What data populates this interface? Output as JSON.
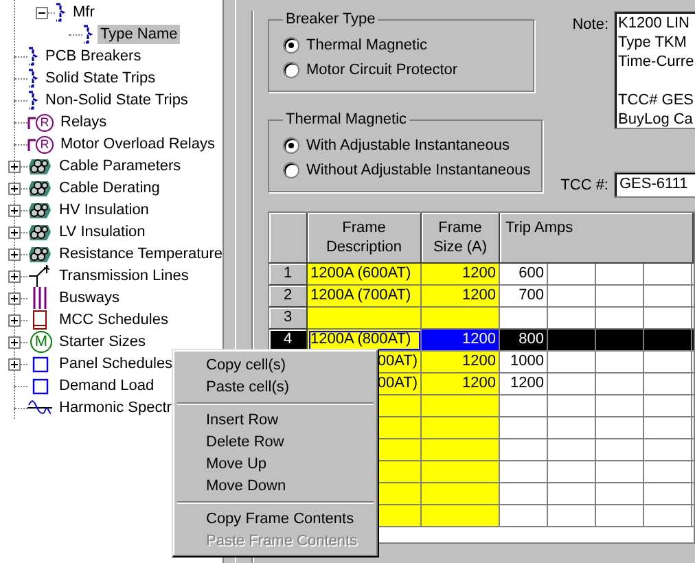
{
  "tree": {
    "continued_children": [
      {
        "label": "Mfr",
        "kind": "bracket",
        "has_children": true,
        "expanded": true,
        "selected": false,
        "children": [
          {
            "label": "Type Name",
            "kind": "bracket",
            "has_children": false,
            "expanded": false,
            "selected": true
          }
        ]
      }
    ],
    "items": [
      {
        "label": "PCB Breakers",
        "kind": "bracket",
        "has_children": false,
        "expanded": false,
        "selected": false
      },
      {
        "label": "Solid State Trips",
        "kind": "bracket",
        "has_children": false,
        "expanded": false,
        "selected": false
      },
      {
        "label": "Non-Solid State Trips",
        "kind": "bracket",
        "has_children": false,
        "expanded": false,
        "selected": false
      },
      {
        "label": "Relays",
        "kind": "relay",
        "badge": "R",
        "has_children": false,
        "expanded": false,
        "selected": false
      },
      {
        "label": "Motor Overload Relays",
        "kind": "relay",
        "badge": "R",
        "has_children": false,
        "expanded": false,
        "selected": false
      },
      {
        "label": "Cable Parameters",
        "kind": "cable",
        "has_children": true,
        "expanded": false,
        "selected": false
      },
      {
        "label": "Cable Derating",
        "kind": "cable",
        "has_children": true,
        "expanded": false,
        "selected": false
      },
      {
        "label": "HV Insulation",
        "kind": "cable",
        "has_children": true,
        "expanded": false,
        "selected": false
      },
      {
        "label": "LV Insulation",
        "kind": "cable",
        "has_children": true,
        "expanded": false,
        "selected": false
      },
      {
        "label": "Resistance Temperature",
        "kind": "cable",
        "has_children": true,
        "expanded": false,
        "selected": false
      },
      {
        "label": "Transmission Lines",
        "kind": "transmission",
        "has_children": true,
        "expanded": false,
        "selected": false
      },
      {
        "label": "Busways",
        "kind": "busway",
        "has_children": true,
        "expanded": false,
        "selected": false
      },
      {
        "label": "MCC Schedules",
        "kind": "mcc",
        "has_children": true,
        "expanded": false,
        "selected": false
      },
      {
        "label": "Starter Sizes",
        "kind": "starter",
        "badge": "M",
        "has_children": true,
        "expanded": false,
        "selected": false
      },
      {
        "label": "Panel Schedules",
        "kind": "panel",
        "has_children": true,
        "expanded": false,
        "selected": false
      },
      {
        "label": "Demand Load",
        "kind": "panel",
        "has_children": false,
        "expanded": false,
        "selected": false
      },
      {
        "label": "Harmonic Spectr",
        "kind": "harmonic",
        "has_children": false,
        "expanded": false,
        "selected": false
      }
    ]
  },
  "breaker_type": {
    "title": "Breaker Type",
    "options": [
      {
        "label": "Thermal Magnetic",
        "selected": true
      },
      {
        "label": "Motor Circuit Protector",
        "selected": false
      }
    ]
  },
  "thermal_magnetic": {
    "title": "Thermal Magnetic",
    "options": [
      {
        "label": "With Adjustable Instantaneous",
        "selected": true
      },
      {
        "label": "Without Adjustable Instantaneous",
        "selected": false
      }
    ]
  },
  "note": {
    "label": "Note:",
    "paragraphs": [
      [
        "K1200 LIN",
        "Type TKM",
        "Time-Curre"
      ],
      [
        "TCC# GES",
        "BuyLog Ca"
      ]
    ]
  },
  "tcc": {
    "label": "TCC #:",
    "value": "GES-6111"
  },
  "table": {
    "columns": [
      "Frame Description",
      "Frame Size (A)",
      "Trip Amps"
    ],
    "rows": [
      {
        "number": "1",
        "description": "1200A (600AT)",
        "frame_size": "1200",
        "trip_amps": "600",
        "selected": false
      },
      {
        "number": "2",
        "description": "1200A (700AT)",
        "frame_size": "1200",
        "trip_amps": "700",
        "selected": false
      },
      {
        "number": "3",
        "selected": false
      },
      {
        "number": "4",
        "description": "1200A (800AT)",
        "frame_size": "1200",
        "trip_amps": "800",
        "selected": true
      },
      {
        "description": "00AT)",
        "frame_size": "1200",
        "trip_amps": "1000",
        "selected": false
      },
      {
        "description": "00AT)",
        "frame_size": "1200",
        "trip_amps": "1200",
        "selected": false
      },
      {
        "selected": false
      },
      {
        "selected": false
      },
      {
        "selected": false
      },
      {
        "selected": false
      },
      {
        "selected": false
      },
      {
        "selected": false
      }
    ]
  },
  "context_menu": {
    "items": [
      {
        "kind": "item",
        "label": "Copy cell(s)",
        "disabled": false
      },
      {
        "kind": "item",
        "label": "Paste cell(s)",
        "disabled": false
      },
      {
        "kind": "separator"
      },
      {
        "kind": "item",
        "label": "Insert Row",
        "disabled": false
      },
      {
        "kind": "item",
        "label": "Delete Row",
        "disabled": false
      },
      {
        "kind": "item",
        "label": "Move Up",
        "disabled": false
      },
      {
        "kind": "item",
        "label": "Move Down",
        "disabled": false
      },
      {
        "kind": "separator"
      },
      {
        "kind": "item",
        "label": "Copy Frame Contents",
        "disabled": false
      },
      {
        "kind": "item",
        "label": "Paste Frame Contents",
        "disabled": true
      }
    ]
  }
}
